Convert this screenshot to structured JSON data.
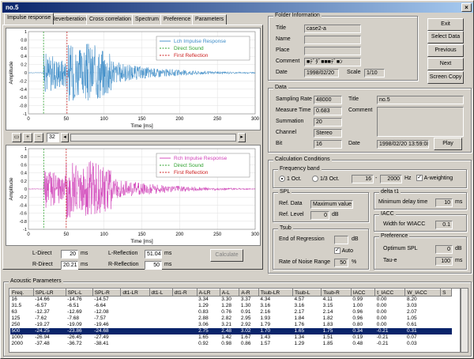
{
  "window": {
    "title": "no.5",
    "close_label": "×"
  },
  "tabs": [
    "Impulse response",
    "Reverberation",
    "Cross correlation",
    "Spectrum",
    "Preference",
    "Parameters"
  ],
  "toolbar": {
    "zoom_value": "32"
  },
  "plots": {
    "ylabel": "Amplitude",
    "xlabel": "Time [ms]",
    "x_ticks": [
      "0",
      "50",
      "100",
      "150",
      "200",
      "250",
      "300"
    ],
    "y_ticks": [
      "1",
      "0.8",
      "0.6",
      "0.4",
      "0.2",
      "0",
      "-0.2",
      "-0.4",
      "-0.6",
      "-0.8",
      "-1"
    ],
    "top": {
      "legend": [
        "Lch Impulse Response",
        "Direct Sound",
        "First Reflection"
      ],
      "color": "#3c8cc8"
    },
    "bottom": {
      "legend": [
        "Rch Impulse Response",
        "Direct Sound",
        "First Reflection"
      ],
      "color": "#d040b8"
    },
    "direct_color": "#2ca02c",
    "reflection_color": "#cc2020"
  },
  "chart_data": [
    {
      "type": "line",
      "ylabel": "Amplitude",
      "xlabel": "Time [ms]",
      "xlim": [
        0,
        300
      ],
      "ylim": [
        -1,
        1
      ],
      "direct_ms": 20,
      "reflection_ms": 51.04,
      "legend": [
        "Lch Impulse Response",
        "Direct Sound",
        "First Reflection"
      ]
    },
    {
      "type": "line",
      "ylabel": "Amplitude",
      "xlabel": "Time [ms]",
      "xlim": [
        0,
        300
      ],
      "ylim": [
        -1,
        1
      ],
      "direct_ms": 20.21,
      "reflection_ms": 50,
      "legend": [
        "Rch Impulse Response",
        "Direct Sound",
        "First Reflection"
      ]
    }
  ],
  "direct": {
    "l_label": "L-Direct",
    "l_value": "20",
    "r_label": "R-Direct",
    "r_value": "20.21",
    "l_ref_label": "L-Reflection",
    "l_ref_value": "51.04",
    "r_ref_label": "R-Reflection",
    "r_ref_value": "50",
    "unit": "ms",
    "calculate": "Calculate"
  },
  "folder": {
    "title": "Folder Information",
    "title_label": "Title",
    "title_value": "case2-a",
    "name_label": "Name",
    "place_label": "Place",
    "comment_label": "Comment",
    "comment_value": "■ﾃﾞﾀﾞ■■■ﾃﾞ■ﾝ",
    "date_label": "Date",
    "date_value": "1998/02/20",
    "scale_label": "Scale",
    "scale_value": "1/10"
  },
  "buttons": {
    "exit": "Exit",
    "select": "Select Data",
    "previous": "Previous",
    "next": "Next",
    "screen_copy": "Screen Copy"
  },
  "data": {
    "title": "Data",
    "sr_label": "Sampling Rate",
    "sr_value": "48000",
    "mt_label": "Measure Time",
    "mt_value": "0.683",
    "sum_label": "Summation",
    "sum_value": "20",
    "ch_label": "Channel",
    "ch_value": "Stereo",
    "bit_label": "Bit",
    "bit_value": "16",
    "title_label": "Title",
    "title_value": "no.5",
    "comment_label": "Comment",
    "date_label": "Date",
    "date_value": "1998/02/20 13:59:08",
    "play": "Play"
  },
  "calc": {
    "title": "Calculation Conditions",
    "freq_title": "Frequency band",
    "oct1": "1 Oct.",
    "oct3": "1/3 Oct.",
    "f_low": "16",
    "f_high": "2000",
    "f_unit": "Hz",
    "a_weight": "A-weighting",
    "spl_title": "SPL",
    "ref_data_label": "Ref. Data",
    "ref_data_value": "Maximum value",
    "ref_level_label": "Ref. Level",
    "ref_level_value": "0",
    "ref_level_unit": "dB",
    "delta_title": "delta t1",
    "min_delay_label": "Minimum delay time",
    "min_delay_value": "10",
    "min_delay_unit": "ms",
    "iacc_title": "IACC",
    "iacc_label": "Width for WIACC",
    "iacc_value": "0.1",
    "tsub_title": "Tsub",
    "end_reg_label": "End of Regression",
    "end_reg_unit": "dB",
    "auto_label": "Auto",
    "rate_label": "Rate of Noise Range",
    "rate_value": "50",
    "rate_unit": "%",
    "pref_title": "Preference",
    "opt_spl_label": "Optimum SPL",
    "opt_spl_value": "0",
    "opt_spl_unit": "dB",
    "taue_label": "Tau-e",
    "taue_value": "100",
    "taue_unit": "ms"
  },
  "acoustic": {
    "title": "Acoustic Parameters",
    "columns": [
      "Freq.",
      "SPL-LR",
      "SPL-L",
      "SPL-R",
      "dt1-LR",
      "dt1-L",
      "dt1-R",
      "A-LR",
      "A-L",
      "A-R",
      "Tsub-LR",
      "Tsub-L",
      "Tsub-R",
      "IACC",
      "t_IACC",
      "W_IACC",
      "S"
    ],
    "rows": [
      [
        "16",
        "-14.66",
        "-14.76",
        "-14.57",
        "",
        "",
        "",
        "3.34",
        "3.30",
        "3.37",
        "4.34",
        "4.57",
        "4.11",
        "0.99",
        "0.00",
        "8.20",
        ""
      ],
      [
        "31.5",
        "-6.57",
        "-6.51",
        "-6.64",
        "",
        "",
        "",
        "1.29",
        "1.28",
        "1.30",
        "3.16",
        "3.16",
        "3.15",
        "1.00",
        "0.00",
        "3.03",
        ""
      ],
      [
        "63",
        "-12.37",
        "-12.69",
        "-12.08",
        "",
        "",
        "",
        "0.83",
        "0.76",
        "0.91",
        "2.16",
        "2.17",
        "2.14",
        "0.96",
        "0.00",
        "2.07",
        ""
      ],
      [
        "125",
        "-7.62",
        "-7.68",
        "-7.57",
        "",
        "",
        "",
        "2.88",
        "2.82",
        "2.95",
        "1.93",
        "1.84",
        "1.82",
        "0.96",
        "0.00",
        "1.05",
        ""
      ],
      [
        "250",
        "-19.27",
        "-19.09",
        "-19.46",
        "",
        "",
        "",
        "3.06",
        "3.21",
        "2.92",
        "1.79",
        "1.76",
        "1.83",
        "0.80",
        "0.00",
        "0.61",
        ""
      ],
      [
        "500",
        "-24.25",
        "-23.86",
        "-24.68",
        "",
        "",
        "",
        "2.75",
        "2.48",
        "3.02",
        "1.70",
        "1.65",
        "1.75",
        "0.34",
        "-0.21",
        "0.31",
        ""
      ],
      [
        "1000",
        "-26.94",
        "-26.45",
        "-27.49",
        "",
        "",
        "",
        "1.65",
        "1.42",
        "1.67",
        "1.43",
        "1.34",
        "1.51",
        "0.19",
        "-0.21",
        "0.07",
        ""
      ],
      [
        "2000",
        "-37.48",
        "-36.72",
        "-38.41",
        "",
        "",
        "",
        "0.92",
        "0.98",
        "0.86",
        "1.57",
        "1.29",
        "1.85",
        "0.48",
        "-0.21",
        "0.03",
        ""
      ]
    ],
    "selected_row": 5
  }
}
